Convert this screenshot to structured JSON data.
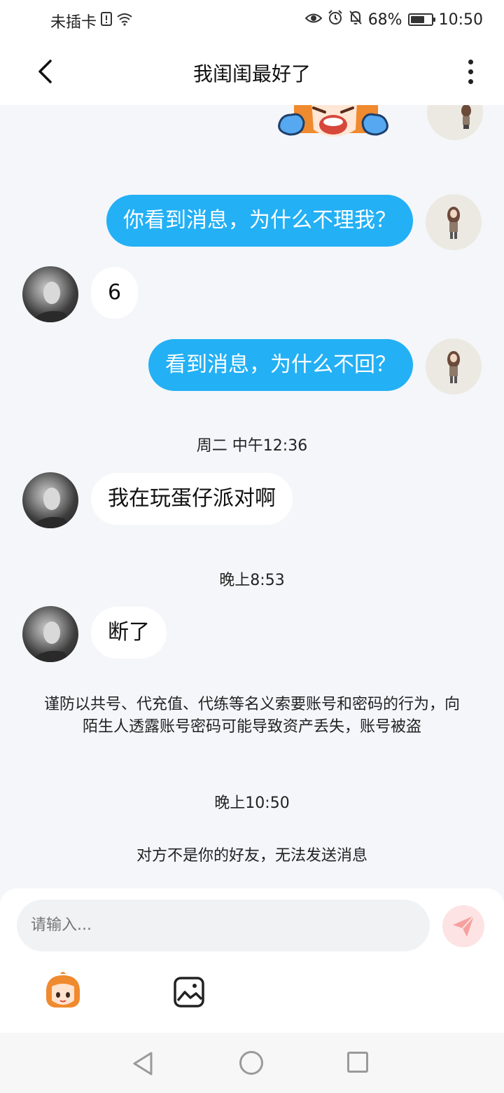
{
  "status_bar": {
    "carrier": "未插卡",
    "battery_percent": "68%",
    "battery_level": 0.68,
    "time": "10:50"
  },
  "header": {
    "title": "我闺闺最好了"
  },
  "messages": [
    {
      "side": "out",
      "text": "你看到消息，为什么不理我？"
    },
    {
      "side": "in",
      "text": "6"
    },
    {
      "side": "out",
      "text": "看到消息，为什么不回？"
    },
    {
      "type": "time",
      "text": "周二 中午12:36"
    },
    {
      "side": "in",
      "text": "我在玩蛋仔派对啊"
    },
    {
      "type": "time",
      "text": "晚上8:53"
    },
    {
      "side": "in",
      "text": "断了"
    },
    {
      "type": "notice",
      "text": "谨防以共号、代充值、代练等名义索要账号和密码的行为，向陌生人透露账号密码可能导致资产丢失，账号被盗"
    },
    {
      "type": "time",
      "text": "晚上10:50"
    },
    {
      "type": "notice",
      "text": "对方不是你的好友，无法发送消息"
    }
  ],
  "composer": {
    "placeholder": "请输入..."
  },
  "colors": {
    "outgoing_bubble": "#23b0f5",
    "incoming_bubble": "#ffffff",
    "chat_background": "#f4f6f9",
    "send_button_disabled": "#fde3e3"
  },
  "icons": {
    "back": "chevron-left-icon",
    "more": "more-vertical-icon",
    "send": "send-icon",
    "emoji": "emoji-sticker-icon",
    "image": "image-icon"
  }
}
